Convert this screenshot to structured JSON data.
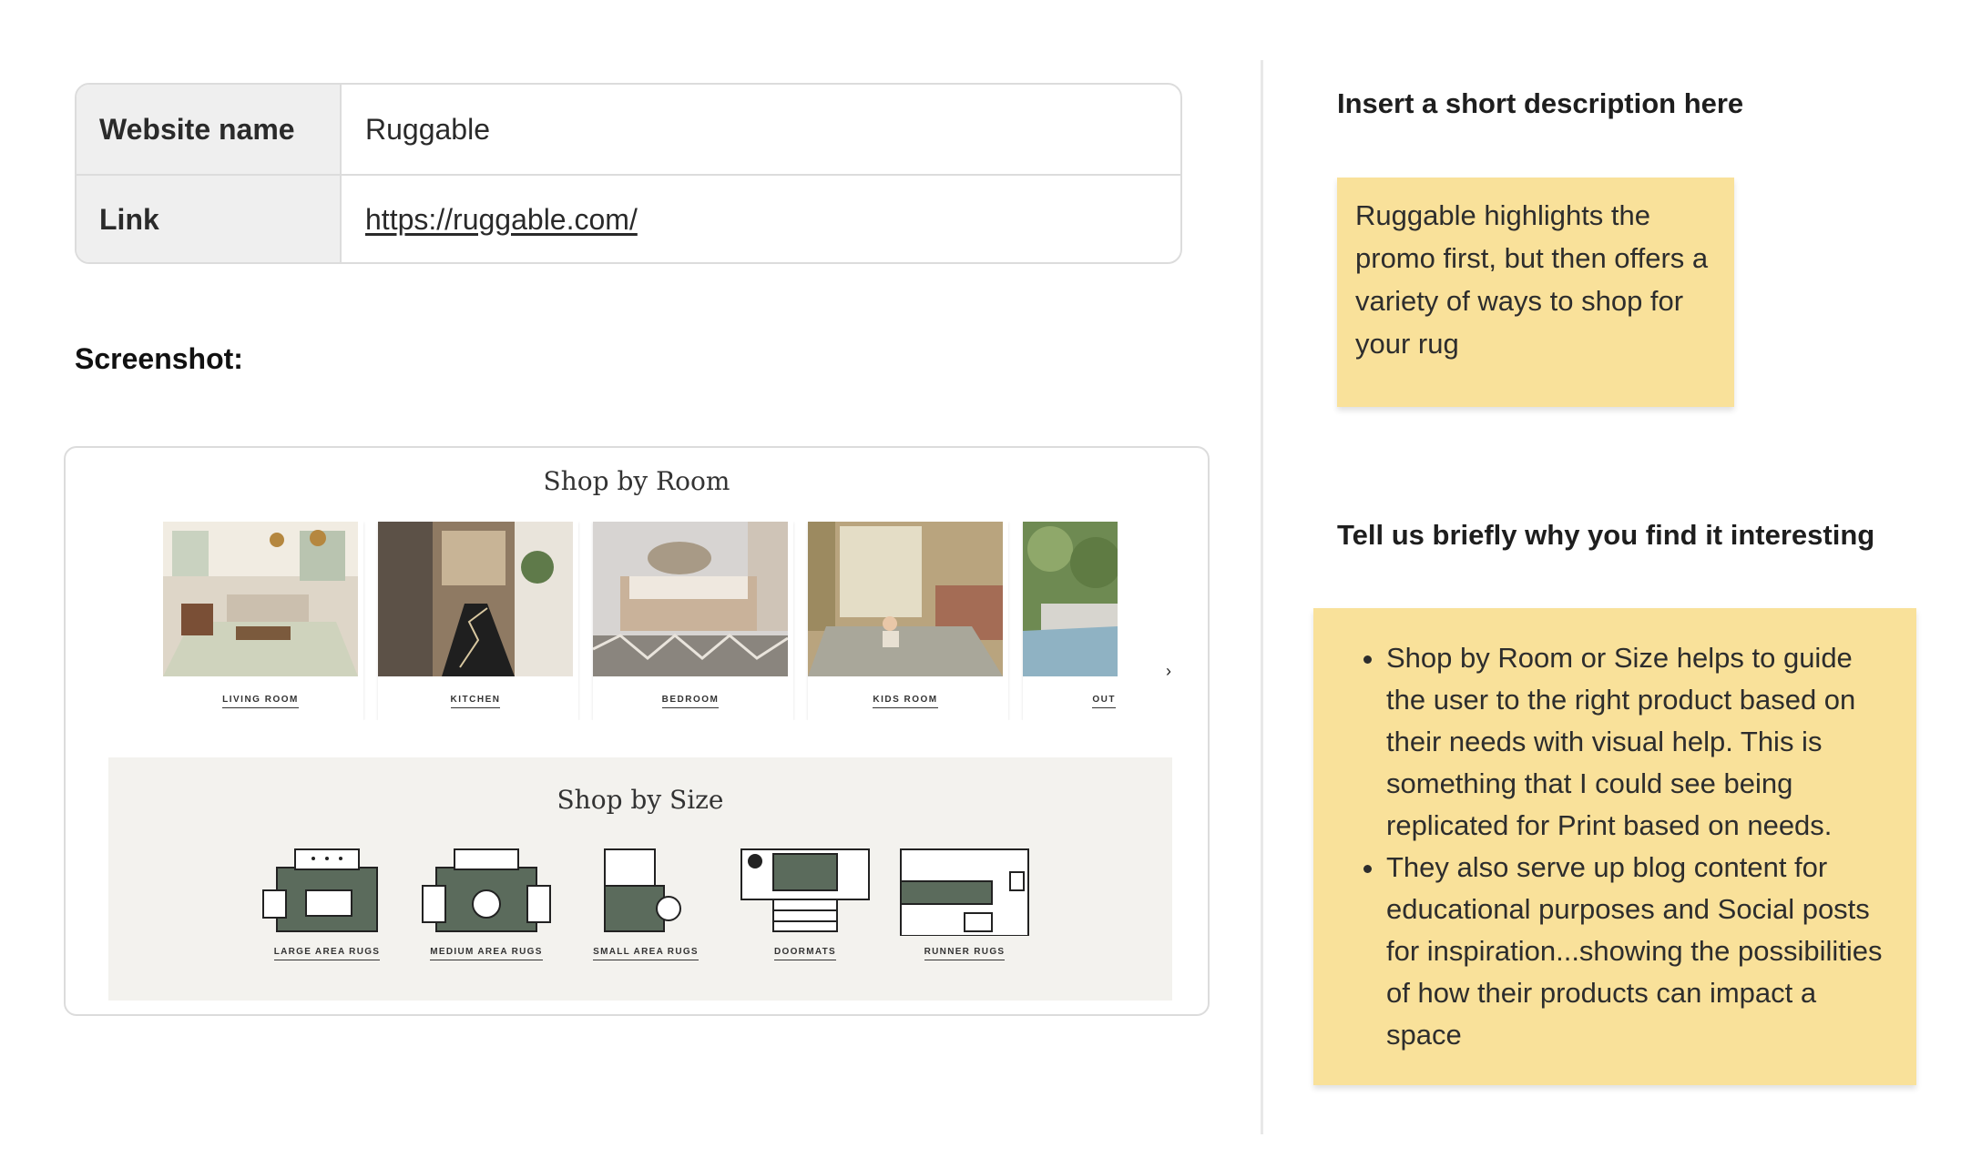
{
  "info_table": {
    "rows": [
      {
        "key": "Website name",
        "value": "Ruggable"
      },
      {
        "key": "Link",
        "value": "https://ruggable.com/"
      }
    ]
  },
  "screenshot_label": "Screenshot:",
  "embedded_screenshot": {
    "shop_by_room": {
      "title": "Shop by Room",
      "rooms": [
        {
          "label": "LIVING ROOM"
        },
        {
          "label": "KITCHEN"
        },
        {
          "label": "BEDROOM"
        },
        {
          "label": "KIDS ROOM"
        },
        {
          "label": "OUT"
        }
      ],
      "next_glyph": "›"
    },
    "shop_by_size": {
      "title": "Shop by Size",
      "sizes": [
        {
          "label": "LARGE AREA RUGS"
        },
        {
          "label": "MEDIUM AREA RUGS"
        },
        {
          "label": "SMALL AREA RUGS"
        },
        {
          "label": "DOORMATS"
        },
        {
          "label": "RUNNER RUGS"
        }
      ]
    },
    "colors": {
      "rug_green": "#5b6b5c",
      "panel_bg": "#f3f2ee"
    }
  },
  "right_panel": {
    "description_heading": "Insert a short description here",
    "description_text": "Ruggable highlights the promo first, but then offers a variety of ways to shop for your rug",
    "interest_heading": "Tell us briefly why you find it interesting",
    "interest_bullets": [
      "Shop by Room or Size helps to guide the user to the right product based on their needs with visual help.  This is something that I could see being replicated for Print based on needs.",
      "They also serve up blog content for educational purposes and Social posts for inspiration...showing the possibilities of how their products can impact a space"
    ],
    "sticky_color": "#f9e19a"
  }
}
